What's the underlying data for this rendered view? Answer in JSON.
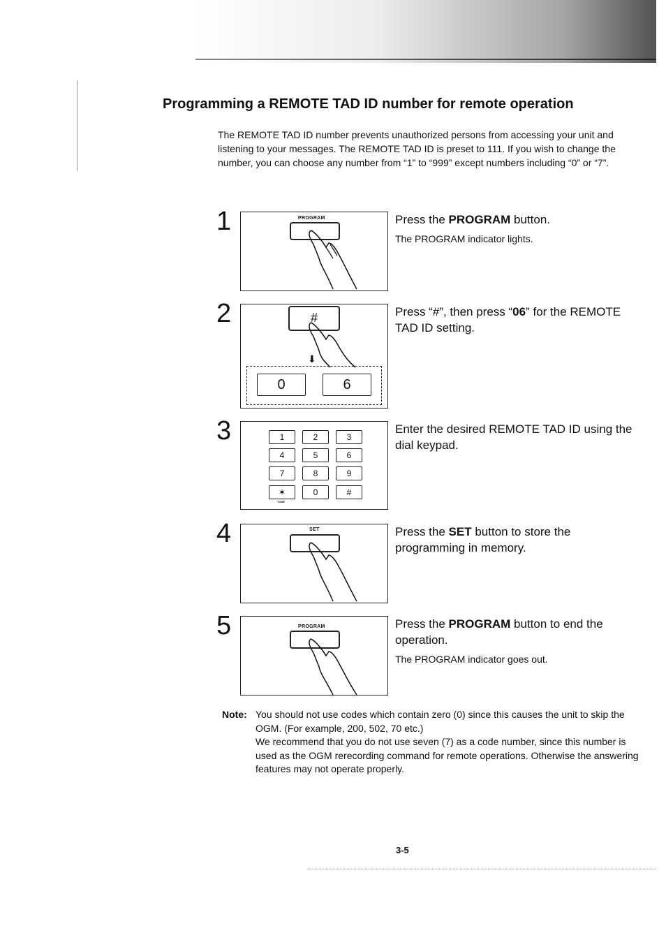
{
  "page": {
    "title": "Programming a REMOTE TAD ID number for remote operation",
    "intro": "The REMOTE TAD ID number prevents unauthorized persons from accessing your unit and listening to your messages. The REMOTE TAD ID is preset to 111. If you wish to change the number, you can choose any number from “1” to “999” except numbers including “0” or “7”.",
    "page_number": "3-5"
  },
  "steps": [
    {
      "number": "1",
      "main_pre": "Press the ",
      "main_bold": "PROGRAM",
      "main_post": " button.",
      "sub": "The PROGRAM indicator lights.",
      "figure_button_label": "PROGRAM"
    },
    {
      "number": "2",
      "main_pre": "Press “#”, then press “",
      "main_bold": "06",
      "main_post": "” for the REMOTE TAD ID setting.",
      "figure_key": "#",
      "figure_keys_below": [
        "0",
        "6"
      ]
    },
    {
      "number": "3",
      "main": "Enter the desired REMOTE TAD ID using the dial keypad.",
      "keypad": [
        "1",
        "2",
        "3",
        "4",
        "5",
        "6",
        "7",
        "8",
        "9",
        "✶",
        "0",
        "#"
      ],
      "keypad_sublabel": "TONE"
    },
    {
      "number": "4",
      "main_pre": "Press the ",
      "main_bold": "SET",
      "main_post": " button to store the programming in memory.",
      "figure_button_label": "SET"
    },
    {
      "number": "5",
      "main_pre": "Press the ",
      "main_bold": "PROGRAM",
      "main_post": " button to end the operation.",
      "sub": "The PROGRAM indicator goes out.",
      "figure_button_label": "PROGRAM"
    }
  ],
  "note": {
    "label": "Note:",
    "line1": "You should not use codes which contain zero (0) since this causes the unit to skip the OGM. (For example, 200, 502, 70 etc.)",
    "line2": "We recommend that you do not use seven (7) as a code number, since this number is used as the OGM rerecording command for remote operations. Otherwise the answering features may not operate properly."
  }
}
